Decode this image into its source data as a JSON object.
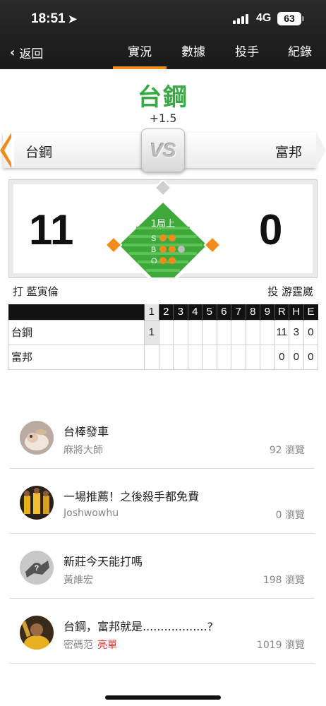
{
  "status_bar": {
    "time": "18:51",
    "network": "4G",
    "battery": "63"
  },
  "nav": {
    "back_label": "返回",
    "tabs": [
      {
        "label": "實況",
        "active": true
      },
      {
        "label": "數據",
        "active": false
      },
      {
        "label": "投手",
        "active": false
      },
      {
        "label": "紀錄",
        "active": false
      }
    ]
  },
  "game": {
    "leader": "台鋼",
    "spread": "+1.5",
    "away_team": "台鋼",
    "home_team": "富邦",
    "vs_label": "VS",
    "away_score": "11",
    "home_score": "0",
    "inning_label": "1局上",
    "count": {
      "s_label": "S",
      "b_label": "B",
      "o_label": "O",
      "strikes": 2,
      "balls": 2,
      "outs": 2
    },
    "batter_label": "打 藍寅倫",
    "pitcher_label": "投 游霆崴"
  },
  "linescore": {
    "headers": [
      "1",
      "2",
      "3",
      "4",
      "5",
      "6",
      "7",
      "8",
      "9",
      "R",
      "H",
      "E"
    ],
    "rows": [
      {
        "team": "台鋼",
        "innings": [
          "1",
          "",
          "",
          "",
          "",
          "",
          "",
          "",
          ""
        ],
        "R": "11",
        "H": "3",
        "E": "0"
      },
      {
        "team": "富邦",
        "innings": [
          "",
          "",
          "",
          "",
          "",
          "",
          "",
          "",
          ""
        ],
        "R": "0",
        "H": "0",
        "E": "0"
      }
    ]
  },
  "posts": [
    {
      "title": "台棒發車",
      "author": "麻將大師",
      "badge": "",
      "views": "92 瀏覽",
      "avatar_icon": "hamster-avatar"
    },
    {
      "title": "一場推薦！之後殺手都免費",
      "author": "Joshwowhu",
      "badge": "",
      "views": "0 瀏覽",
      "avatar_icon": "team-players-avatar"
    },
    {
      "title": "新莊今天能打嗎",
      "author": "黃維宏",
      "badge": "",
      "views": "198 瀏覽",
      "avatar_icon": "default-avatar"
    },
    {
      "title": "台鋼，富邦就是..................?",
      "author": "密碼范",
      "badge": "亮單",
      "views": "1019 瀏覽",
      "avatar_icon": "player-avatar"
    }
  ],
  "colors": {
    "accent": "#f18b1c",
    "leader_green": "#3aa844",
    "field_green": "#3fa83a",
    "badge_red": "#e0322a"
  }
}
